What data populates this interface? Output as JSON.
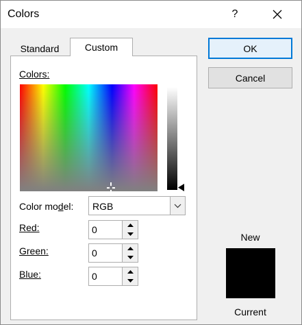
{
  "window": {
    "title": "Colors",
    "help_label": "?"
  },
  "tabs": [
    {
      "label": "Standard",
      "selected": false
    },
    {
      "label": "Custom",
      "selected": true
    }
  ],
  "custom": {
    "colors_label": "Colors:",
    "color_model": {
      "label": "Color model:",
      "value": "RGB"
    },
    "red": {
      "label": "Red:",
      "value": "0"
    },
    "green": {
      "label": "Green:",
      "value": "0"
    },
    "blue": {
      "label": "Blue:",
      "value": "0"
    }
  },
  "buttons": {
    "ok_label": "OK",
    "cancel_label": "Cancel"
  },
  "preview": {
    "new_label": "New",
    "current_label": "Current",
    "new_color": "#000000",
    "current_color": "#000000"
  },
  "luminance": {
    "level": 0
  },
  "icons": {
    "close": "close-icon",
    "dropdown": "chevron-down-icon",
    "spin_up": "spin-up-icon",
    "spin_down": "spin-down-icon",
    "crosshair": "crosshair-icon",
    "luminance_pointer": "triangle-left-icon"
  },
  "colors": {
    "accent": "#0078d7",
    "dialog_background": "#f0f0f0",
    "panel_background": "#ffffff",
    "button_background": "#e1e1e1"
  }
}
